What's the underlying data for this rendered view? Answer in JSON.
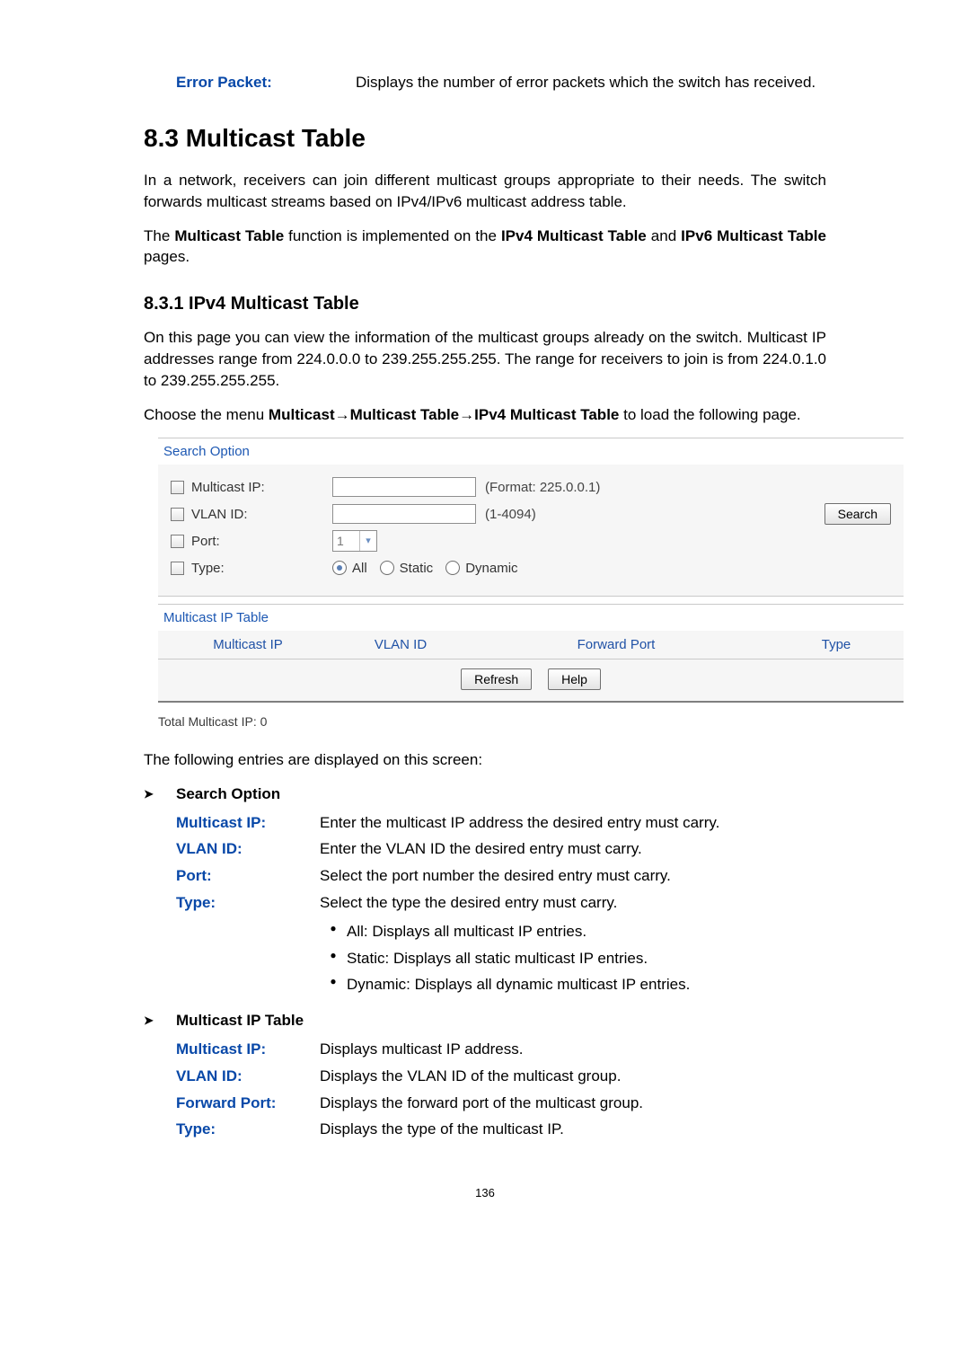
{
  "error_packet": {
    "term": "Error Packet:",
    "desc": "Displays the number of error packets which the switch has received."
  },
  "sec83": {
    "heading": "8.3 Multicast Table",
    "p1": "In a network, receivers can join different multicast groups appropriate to their needs. The switch forwards multicast streams based on IPv4/IPv6 multicast address table.",
    "p2_pre": "The ",
    "p2_b1": "Multicast Table",
    "p2_mid1": " function is implemented on the ",
    "p2_b2": "IPv4 Multicast Table",
    "p2_mid2": " and ",
    "p2_b3": "IPv6 Multicast Table",
    "p2_post": " pages."
  },
  "sec831": {
    "heading": "8.3.1 IPv4 Multicast Table",
    "p1": "On this page you can view the information of the multicast groups already on the switch. Multicast IP addresses range from 224.0.0.0 to 239.255.255.255. The range for receivers to join is from 224.0.1.0 to 239.255.255.255.",
    "p2_pre": "Choose the menu ",
    "p2_b": "Multicast→Multicast Table→IPv4 Multicast Table",
    "p2_post": " to load the following page."
  },
  "ui": {
    "search_option": "Search Option",
    "multicast_ip_label": "Multicast IP:",
    "multicast_ip_hint": "(Format: 225.0.0.1)",
    "vlan_label": "VLAN ID:",
    "vlan_hint": "(1-4094)",
    "port_label": "Port:",
    "port_value": "1",
    "type_label": "Type:",
    "type_all": "All",
    "type_static": "Static",
    "type_dynamic": "Dynamic",
    "search_btn": "Search",
    "table_title": "Multicast IP Table",
    "col_multicast_ip": "Multicast IP",
    "col_vlan": "VLAN ID",
    "col_forward": "Forward Port",
    "col_type": "Type",
    "refresh_btn": "Refresh",
    "help_btn": "Help",
    "total": "Total Multicast IP: 0"
  },
  "entries": {
    "lead": "The following entries are displayed on this screen:",
    "search_option_head": "Search Option",
    "so_multicast_ip_t": "Multicast IP:",
    "so_multicast_ip_d": "Enter the multicast IP address the desired entry must carry.",
    "so_vlan_t": "VLAN ID:",
    "so_vlan_d": "Enter the VLAN ID the desired entry must carry.",
    "so_port_t": "Port:",
    "so_port_d": "Select the port number the desired entry must carry.",
    "so_type_t": "Type:",
    "so_type_d": "Select the type the desired entry must carry.",
    "so_type_b1": "All: Displays all multicast IP entries.",
    "so_type_b2": "Static: Displays all static multicast IP entries.",
    "so_type_b3": "Dynamic: Displays all dynamic multicast IP entries.",
    "mip_table_head": "Multicast IP Table",
    "mt_multicast_ip_t": "Multicast IP:",
    "mt_multicast_ip_d": "Displays multicast IP address.",
    "mt_vlan_t": "VLAN ID:",
    "mt_vlan_d": "Displays the VLAN ID of the multicast group.",
    "mt_forward_t": "Forward Port:",
    "mt_forward_d": "Displays the forward port of the multicast group.",
    "mt_type_t": "Type:",
    "mt_type_d": "Displays the type of the multicast IP."
  },
  "page_number": "136"
}
